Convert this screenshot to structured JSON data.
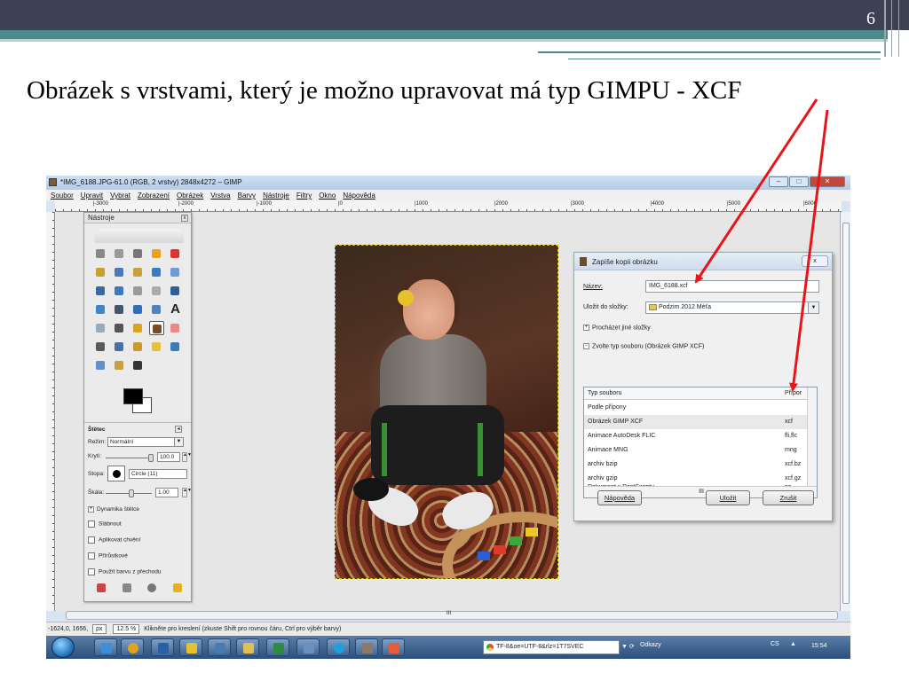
{
  "slide": {
    "page_number": "6",
    "title": "Obrázek s vrstvami, který je možno upravovat má typ GIMPU - XCF"
  },
  "window": {
    "title": "*IMG_6188.JPG-61.0 (RGB, 2 vrstvy) 2848x4272 – GIMP",
    "menu": [
      "Soubor",
      "Upravit",
      "Vybrat",
      "Zobrazení",
      "Obrázek",
      "Vrstva",
      "Barvy",
      "Nástroje",
      "Filtry",
      "Okno",
      "Nápověda"
    ],
    "ruler_labels": [
      "|-3000",
      "|-2000",
      "|-1000",
      "|0",
      "|1000",
      "|2000",
      "|3000",
      "|4000",
      "|5000",
      "|6000"
    ]
  },
  "toolbox": {
    "title": "Nástroje",
    "section": "Štětec",
    "mode_label": "Režim:",
    "mode_value": "Normální",
    "opacity_label": "Krytí:",
    "opacity_value": "100.0",
    "opacity_fraction": 1.0,
    "brush_label": "Stopa:",
    "brush_value": "Circle (11)",
    "scale_label": "Škála:",
    "scale_value": "1.00",
    "dynamics": "Dynamika štětce",
    "checks": [
      "Slábnout",
      "Aplikovat chvění",
      "Přírůstkové",
      "Použít barvu z přechodu"
    ]
  },
  "dialog": {
    "title": "Zapíše kopii obrázku",
    "name_label": "Název:",
    "name_value": "IMG_6188.xcf",
    "folder_label": "Uložit do složky:",
    "folder_value": "Podzim 2012 Méťa",
    "browse": "Procházet jiné složky",
    "filetype_toggle": "Zvolte typ souboru (Obrázek GIMP XCF)",
    "col_type": "Typ souboru",
    "col_ext": "Přípor",
    "rows": [
      {
        "type": "Podle přípony",
        "ext": ""
      },
      {
        "type": "Obrázek GIMP XCF",
        "ext": "xcf"
      },
      {
        "type": "Animace AutoDesk FLIC",
        "ext": "fli,flc"
      },
      {
        "type": "Animace MNG",
        "ext": "mng"
      },
      {
        "type": "archiv bzip",
        "ext": "xcf.bz"
      },
      {
        "type": "archiv gzip",
        "ext": "xcf.gz"
      },
      {
        "type": "Dokument v PostScriptu",
        "ext": "ps"
      }
    ],
    "hscroll_text": "III",
    "help_button": "Nápověda",
    "save_button": "Uložit",
    "cancel_button": "Zrušit"
  },
  "statusbar": {
    "coords": "-1624,0, 1656,",
    "unit": "px",
    "zoom": "12.5 %",
    "hint": "Klikněte pro kreslení (zkuste Shift pro rovnou čáru, Ctrl pro výběr barvy)"
  },
  "hscroll_text": "III",
  "taskbar": {
    "url": "TF-8&oe=UTF-8&rlz=1T7SVEC",
    "odkazy": "Odkazy",
    "lang": "CS",
    "time": "15:54"
  },
  "colors": {
    "topbar": "#3d4153",
    "teal": "#4f8a8b",
    "arrow": "#e8141a"
  }
}
